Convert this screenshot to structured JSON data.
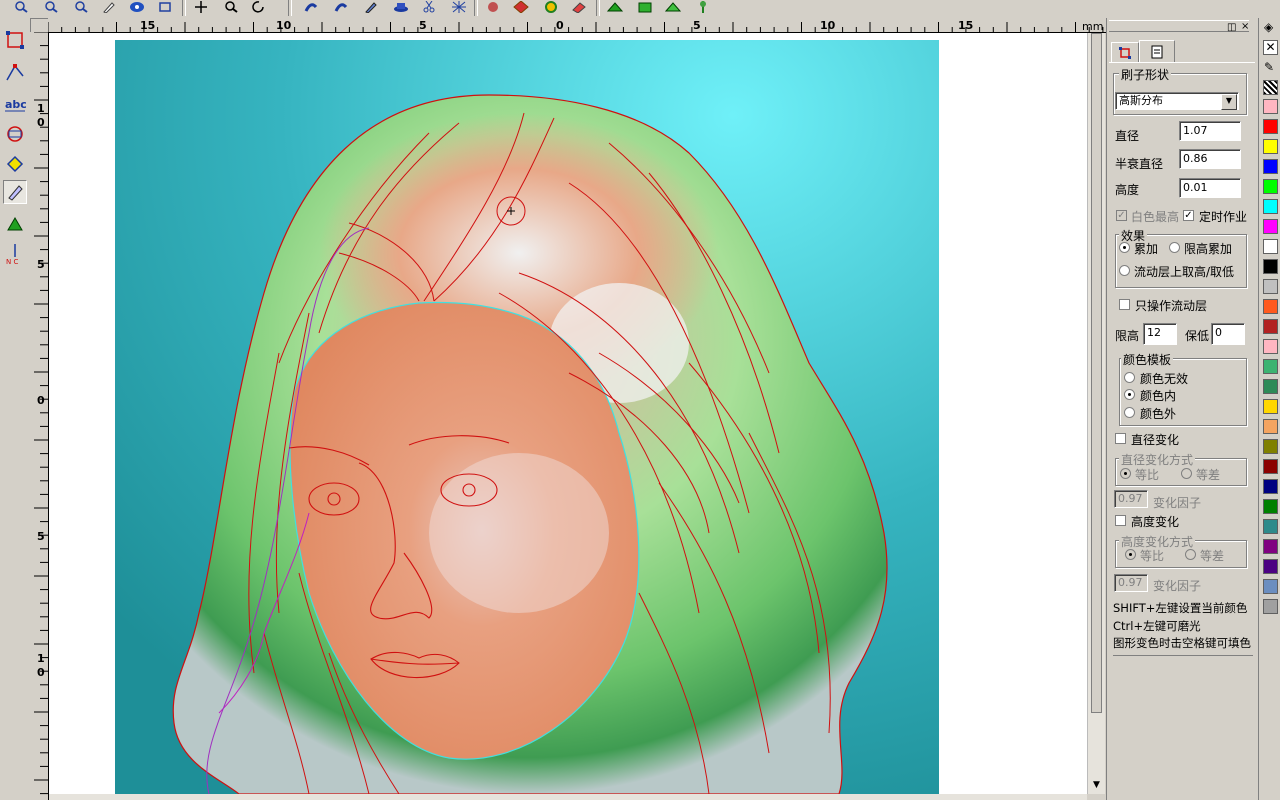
{
  "ruler": {
    "unit": "mm",
    "h_labels": [
      "15",
      "10",
      "5",
      "0",
      "5",
      "10",
      "15"
    ],
    "v_labels": [
      "1\n0",
      "5",
      "0",
      "5",
      "1\n0"
    ]
  },
  "panel": {
    "tabs": [
      "brush-tab",
      "page-tab"
    ],
    "brush_shape_group": "刷子形状",
    "brush_type": "高斯分布",
    "diameter_label": "直径",
    "diameter_value": "1.07",
    "half_decay_label": "半衰直径",
    "half_decay_value": "0.86",
    "height_label": "高度",
    "height_value": "0.01",
    "white_highest_label": "白色最高",
    "white_highest_checked": true,
    "timed_label": "定时作业",
    "timed_checked": true,
    "effect_group": "效果",
    "effect_add": "累加",
    "effect_limit_add": "限高累加",
    "effect_flow": "流动层上取高/取低",
    "effect_selected": "累加",
    "only_flow_label": "只操作流动层",
    "only_flow_checked": false,
    "limit_high_label": "限高",
    "limit_high_value": "12",
    "keep_low_label": "保低",
    "keep_low_value": "0",
    "color_template_group": "颜色模板",
    "color_invalid": "颜色无效",
    "color_inside": "颜色内",
    "color_outside": "颜色外",
    "color_selected": "颜色内",
    "diameter_change_label": "直径变化",
    "diameter_change_checked": false,
    "diameter_mode_group": "直径变化方式",
    "ratio_label": "等比",
    "diff_label": "等差",
    "diameter_factor_value": "0.97",
    "factor_label": "变化因子",
    "height_change_label": "高度变化",
    "height_change_checked": false,
    "height_mode_group": "高度变化方式",
    "height_factor_value": "0.97",
    "hint1": "SHIFT+左键设置当前颜色",
    "hint2": "Ctrl+左键可磨光",
    "hint3": "图形变色时击空格键可填色"
  },
  "palette": {
    "colors": [
      "#ffb6c1",
      "#ff0000",
      "#ffff00",
      "#0000ff",
      "#00ff00",
      "#00ffff",
      "#ff00ff",
      "#ffffff",
      "#000000",
      "#c0c0c0",
      "#ff5a1e",
      "#b22222",
      "#ffb6c1",
      "#3cb371",
      "#2e8b57",
      "#ffd700",
      "#f4a460",
      "#808000",
      "#8b0000",
      "#000080",
      "#008000",
      "#2e8b8b",
      "#800080",
      "#4b0082",
      "#6b8ec0",
      "#a0a0a0"
    ]
  }
}
